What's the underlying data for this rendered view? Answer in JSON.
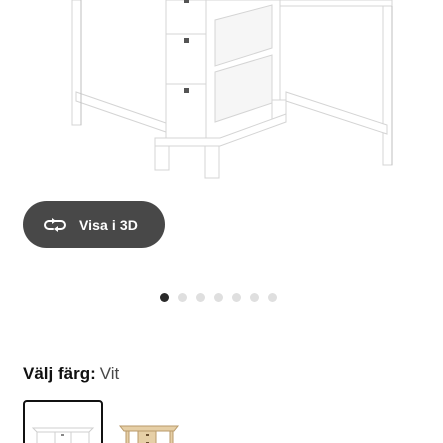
{
  "product_image": {
    "alt_icon": "folding-table-icon"
  },
  "view_3d_button": {
    "label": "Visa i 3D",
    "icon": "rotate-3d-icon"
  },
  "carousel": {
    "dot_count": 7,
    "active_index": 0
  },
  "color_picker": {
    "label": "Välj färg:",
    "selected_value": "Vit",
    "swatches": [
      {
        "color_name": "white",
        "hex": "#ffffff",
        "selected": true
      },
      {
        "color_name": "birch",
        "hex": "#e6cfa6",
        "selected": false
      }
    ]
  },
  "colors": {
    "button_bg": "#484848",
    "dot_active": "#2a2a2a",
    "dot_inactive": "#dfdfdf",
    "text_primary": "#111111",
    "text_secondary": "#484848"
  }
}
